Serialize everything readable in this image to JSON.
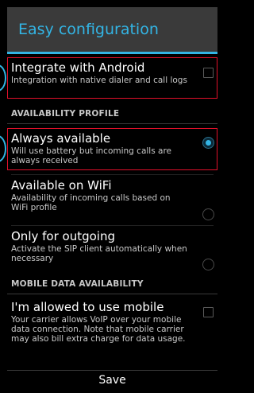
{
  "header": {
    "title": "Easy configuration"
  },
  "colors": {
    "accent": "#33b5e5",
    "highlight": "#e1102a",
    "header_bg": "#3a3a3a"
  },
  "integrate": {
    "title": "Integrate with Android",
    "summary": "Integration with native dialer and call logs",
    "checked": false,
    "control_icon": "checkbox"
  },
  "availability": {
    "section_label": "AVAILABILITY PROFILE",
    "options": [
      {
        "title": "Always available",
        "summary": "Will use battery but incoming calls are always received",
        "selected": true,
        "control_icon": "radio-selected"
      },
      {
        "title": "Available on WiFi",
        "summary": "Availability of incoming calls based on WiFi profile",
        "selected": false,
        "control_icon": "radio"
      },
      {
        "title": "Only for outgoing",
        "summary": "Activate the SIP client automatically when necessary",
        "selected": false,
        "control_icon": "radio"
      }
    ]
  },
  "mobile_data": {
    "section_label": "MOBILE DATA AVAILABILITY",
    "title": "I'm allowed to use mobile",
    "summary": "Your carrier allows VoIP over your mobile data connection. Note that mobile carrier may also bill extra charge for data usage.",
    "checked": false,
    "control_icon": "checkbox"
  },
  "footer": {
    "save_label": "Save"
  }
}
